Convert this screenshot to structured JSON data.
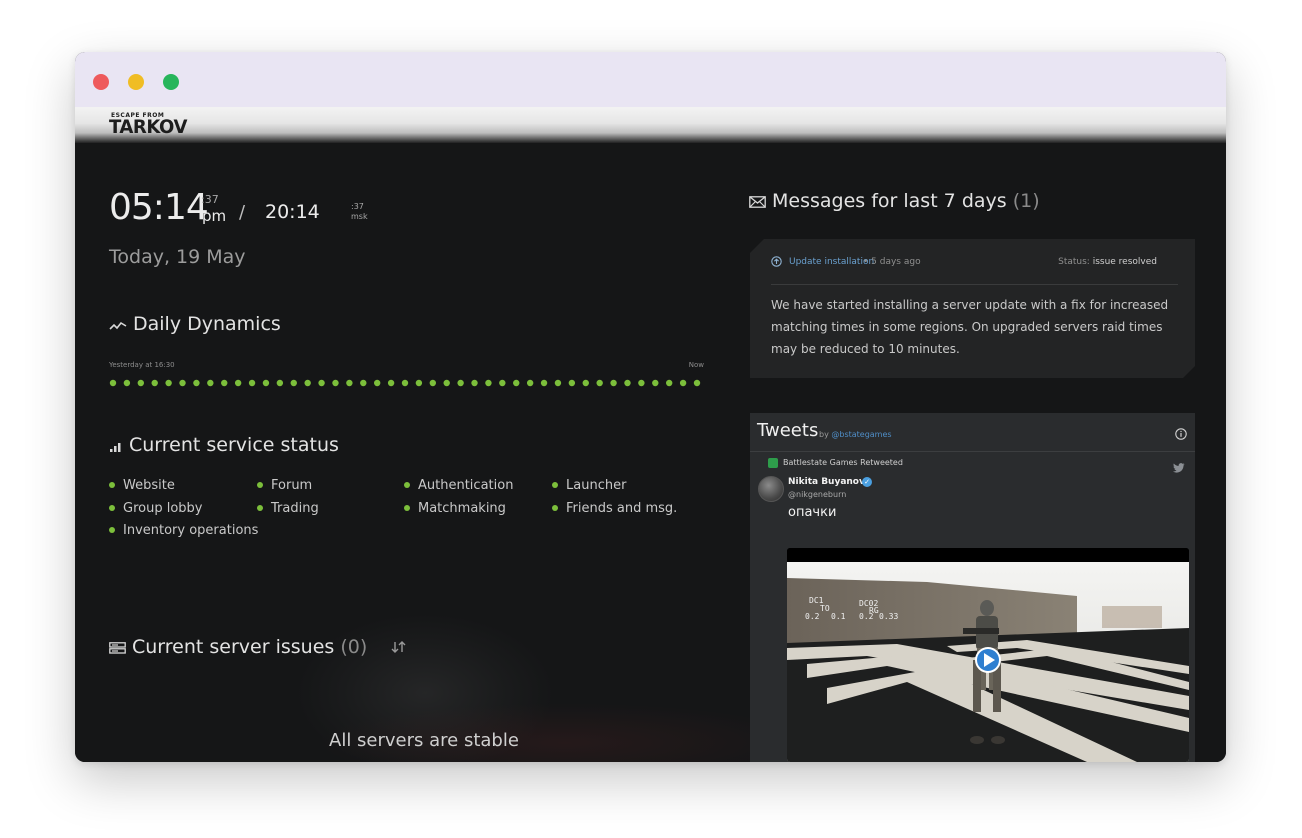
{
  "header": {
    "logo_small": "ESCAPE FROM",
    "logo_big": "TARKOV"
  },
  "clock": {
    "local_time": "05:14",
    "local_seconds": ":37",
    "ampm": "pm",
    "slash": "/",
    "msk_time": "20:14",
    "msk_seconds": ":37",
    "msk_label": "msk",
    "date": "Today, 19 May"
  },
  "dynamics": {
    "title": "Daily Dynamics",
    "start_label": "Yesterday at 16:30",
    "end_label": "Now",
    "points": 43,
    "color": "#7cbf3b"
  },
  "service_status": {
    "title": "Current service status",
    "items": [
      {
        "label": "Website"
      },
      {
        "label": "Forum"
      },
      {
        "label": "Authentication"
      },
      {
        "label": "Launcher"
      },
      {
        "label": "Group lobby"
      },
      {
        "label": "Trading"
      },
      {
        "label": "Matchmaking"
      },
      {
        "label": "Friends and msg."
      },
      {
        "label": "Inventory operations"
      }
    ]
  },
  "server_issues": {
    "title": "Current server issues",
    "count": "(0)",
    "stable_text": "All servers are stable"
  },
  "messages": {
    "title": "Messages for last 7 days",
    "count": "(1)",
    "item": {
      "link": "Update installation",
      "ago": "• 5 days ago",
      "status_label": "Status:",
      "status_value": "issue resolved",
      "body": "We have started installing a server update with a fix for increased matching times in some regions. On upgraded servers raid times may be reduced to 10 minutes."
    }
  },
  "tweets": {
    "title": "Tweets",
    "by": "by",
    "account": "@bstategames",
    "retweeted_by": "Battlestate Games Retweeted",
    "author": "Nikita Buyanov",
    "handle": "@nikgeneburn",
    "text": "опачки",
    "media_labels": [
      "DC1",
      "TO",
      "0.2",
      "0.1",
      "DC02",
      "RG",
      "0.2",
      "0.33"
    ]
  },
  "colors": {
    "accent_green": "#7cbf3b",
    "link_blue": "#6aa0cf",
    "background": "#151617"
  }
}
